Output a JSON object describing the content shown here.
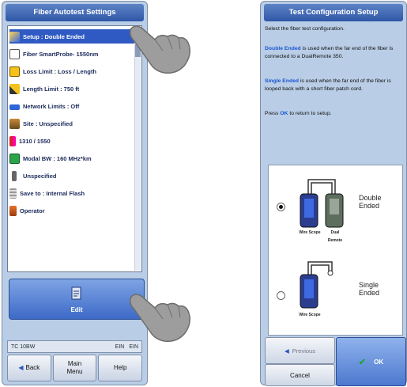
{
  "left_screen": {
    "title": "Fiber Autotest Settings",
    "items": [
      {
        "label": "Setup : Double Ended",
        "icon": "setup-icon"
      },
      {
        "label": "Fiber SmartProbe- 1550nm",
        "icon": "smartprobe-icon"
      },
      {
        "label": "Loss Limit : Loss / Length",
        "icon": "loss-limit-icon"
      },
      {
        "label": "Length Limit : 750 ft",
        "icon": "length-limit-icon"
      },
      {
        "label": "Network Limits : Off",
        "icon": "network-limits-icon"
      },
      {
        "label": "Site : Unspecified",
        "icon": "site-icon"
      },
      {
        "label": "1310 / 1550",
        "icon": "wavelength-icon"
      },
      {
        "label": "Modal BW : 160 MHz*km",
        "icon": "modal-bw-icon"
      },
      {
        "label": "Unspecified",
        "icon": "cable-icon"
      },
      {
        "label": "Save to : Internal Flash",
        "icon": "save-icon"
      },
      {
        "label": "Operator",
        "icon": "operator-icon"
      }
    ],
    "big_button_label": "Edit",
    "status": {
      "left": "TC 10BW",
      "mid": "EIN",
      "right": "EIN"
    },
    "softkeys": {
      "back": "Back",
      "main_menu": "Main Menu",
      "help": "Help"
    }
  },
  "right_screen": {
    "title": "Test Configuration Setup",
    "intro": "Select the fiber test configuration.",
    "double_keyword": "Double Ended",
    "double_desc": "is used when the far end of the fiber is connected to a DualRemote 350.",
    "single_keyword": "Single Ended",
    "single_desc": "is used when the far end of the fiber is looped back with a short fiber patch cord.",
    "press_prefix": "Press",
    "press_ok": "OK",
    "press_suffix": "to return to setup.",
    "option_double_line1": "Double",
    "option_double_line2": "Ended",
    "option_single_line1": "Single",
    "option_single_line2": "Ended",
    "device_main_label": "Wire Scope",
    "device_remote_label": "Dual Remote",
    "buttons": {
      "previous": "Previous",
      "cancel": "Cancel",
      "ok": "OK"
    }
  },
  "colors": {
    "titlebar": "#2e57a8",
    "selected": "#2f5ac4",
    "panel": "#b9cde6",
    "ok_button": "#4d79cf"
  }
}
